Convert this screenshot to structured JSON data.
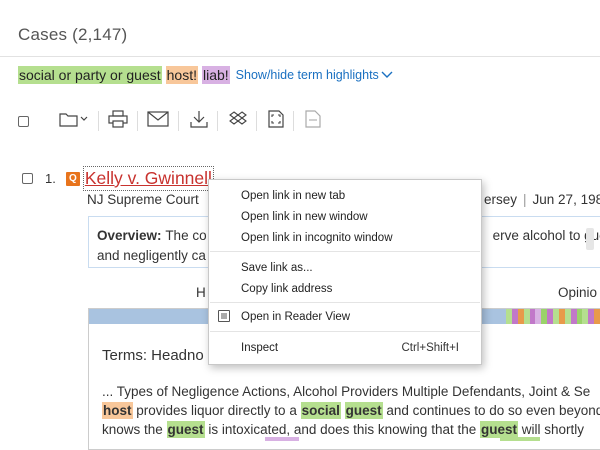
{
  "header": {
    "title": "Cases (2,147)"
  },
  "term_highlights": {
    "terms": [
      {
        "text": "social or party or guest",
        "color": "#b5df8f"
      },
      {
        "text": "host!",
        "color": "#f8c79a"
      },
      {
        "text": "liab!",
        "color": "#d8b1e3"
      }
    ],
    "toggle_label": "Show/hide term highlights"
  },
  "toolbar": {
    "icons": [
      "folder-icon",
      "print-icon",
      "email-icon",
      "download-icon",
      "dropbox-icon",
      "fullscreen-icon",
      "document-icon"
    ]
  },
  "result": {
    "number": "1.",
    "badge": "Q",
    "case_title": "Kelly v. Gwinnell",
    "court": "NJ Supreme Court",
    "jurisdiction_fragment": "ersey",
    "date_fragment": "Jun 27, 198",
    "overview_label": "Overview:",
    "overview_line1_start": "The co",
    "overview_line1_end": "erve alcohol to guest",
    "overview_line2_start": "and negligently ca",
    "headnotes_label_fragment": "H",
    "opinion_label_fragment": "Opinio",
    "terms_heading_fragment": "Terms: Headno",
    "snippet": {
      "line1": "... Types of Negligence Actions, Alcohol Providers Multiple Defendants, Joint & Se",
      "line2": [
        "host",
        " provides liquor directly to a ",
        "social",
        " ",
        "guest",
        " and continues to do so even beyond"
      ],
      "line3": [
        "knows the ",
        "guest",
        " is intoxicated, and does this knowing that the ",
        "guest",
        " will shortly"
      ]
    }
  },
  "context_menu": {
    "items": [
      {
        "label": "Open link in new tab"
      },
      {
        "label": "Open link in new window"
      },
      {
        "label": "Open link in incognito window"
      },
      {
        "label": "Save link as..."
      },
      {
        "label": "Copy link address"
      },
      {
        "label": "Open in Reader View"
      },
      {
        "label": "Inspect",
        "shortcut": "Ctrl+Shift+I"
      }
    ]
  }
}
